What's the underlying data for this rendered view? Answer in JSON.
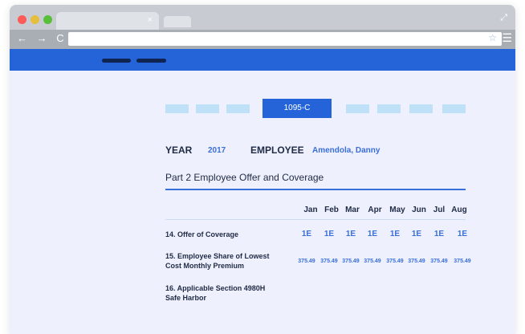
{
  "browser": {
    "tab_close": "×",
    "expand_glyph": "⤢",
    "nav_glyphs": "← → C",
    "star_glyph": "☆",
    "menu_glyph": "☰",
    "traffic_lights": [
      "#fc5b57",
      "#e5bf3c",
      "#57c038"
    ]
  },
  "app": {
    "accent": "#2463d8",
    "form_tab": "1095-C",
    "year_label": "YEAR",
    "year_value": "2017",
    "employee_label": "EMPLOYEE",
    "employee_value": "Amendola, Danny",
    "section_title": "Part 2 Employee Offer and Coverage",
    "months": [
      "Jan",
      "Feb",
      "Mar",
      "Apr",
      "May",
      "Jun",
      "Jul",
      "Aug"
    ],
    "rows": [
      {
        "label_line1": "14. Offer of Coverage",
        "label_line2": "",
        "values": [
          "1E",
          "1E",
          "1E",
          "1E",
          "1E",
          "1E",
          "1E",
          "1E"
        ]
      },
      {
        "label_line1": "15. Employee Share of Lowest",
        "label_line2": "Cost Monthly Premium",
        "values": [
          "375.49",
          "375.49",
          "375.49",
          "375.49",
          "375.49",
          "375.49",
          "375.49",
          "375.49"
        ]
      },
      {
        "label_line1": "16. Applicable Section 4980H",
        "label_line2": "Safe Harbor",
        "values": []
      }
    ]
  }
}
